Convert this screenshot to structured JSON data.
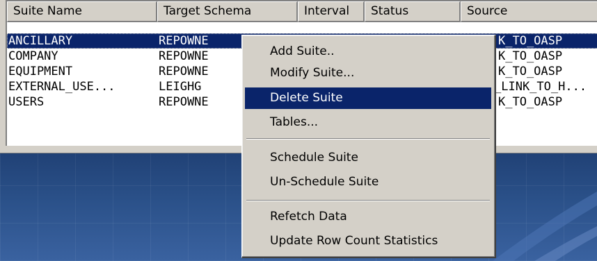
{
  "columns": [
    "Suite Name",
    "Target Schema",
    "Interval",
    "Status",
    "Source"
  ],
  "rows": [
    {
      "name": "ANCILLARY",
      "schema": "REPOWNE",
      "source": "K_TO_OASP",
      "selected": true
    },
    {
      "name": "COMPANY",
      "schema": "REPOWNE",
      "source": "K_TO_OASP",
      "selected": false
    },
    {
      "name": "EQUIPMENT",
      "schema": "REPOWNE",
      "source": "K_TO_OASP",
      "selected": false
    },
    {
      "name": "EXTERNAL_USE...",
      "schema": "LEIGHG",
      "source": "_LINK_TO_H...",
      "selected": false
    },
    {
      "name": "USERS",
      "schema": "REPOWNE",
      "source": "K_TO_OASP",
      "selected": false
    }
  ],
  "context_menu": {
    "items": [
      {
        "label": "Add Suite..",
        "highlighted": false
      },
      {
        "label": "Modify Suite...",
        "highlighted": false
      },
      {
        "label": "Delete Suite",
        "highlighted": true
      },
      {
        "label": "Tables...",
        "highlighted": false
      },
      {
        "label": "Schedule Suite",
        "highlighted": false
      },
      {
        "label": "Un-Schedule Suite",
        "highlighted": false
      },
      {
        "label": "Refetch Data",
        "highlighted": false
      },
      {
        "label": "Update Row Count Statistics",
        "highlighted": false
      }
    ]
  },
  "colors": {
    "selection": "#0a246a",
    "face": "#d4d0c8",
    "backdrop": "#2a5088"
  }
}
